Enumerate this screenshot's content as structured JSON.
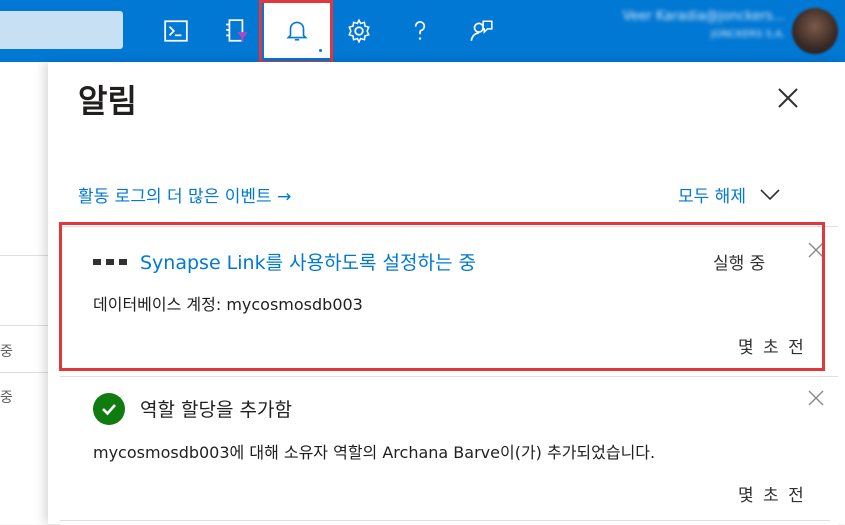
{
  "topbar": {
    "icons": [
      "cloud-shell-icon",
      "directory-filter-icon",
      "notifications-bell-icon",
      "settings-gear-icon",
      "help-question-icon",
      "feedback-icon"
    ],
    "user_name": "Veer Karadia@jonckers...",
    "user_org": "JONCKERS S.A."
  },
  "panel": {
    "title": "알림",
    "more_events_link": "활동 로그의 더 많은 이벤트",
    "dismiss_all": "모두 해제"
  },
  "notifications": [
    {
      "title": "Synapse Link를 사용하도록 설정하는 중",
      "status": "실행 중",
      "description": "데이터베이스 계정: mycosmosdb003",
      "time": "몇 초 전"
    },
    {
      "title": "역할 할당을 추가함",
      "description": "mycosmosdb003에 대해 소유자 역할의 Archana Barve이(가) 추가되었습니다.",
      "time": "몇 초 전"
    }
  ],
  "background": {
    "left_chars": [
      "중",
      "중"
    ]
  },
  "colors": {
    "accent": "#0078d4",
    "highlight": "#e1393b",
    "success": "#107c10"
  }
}
